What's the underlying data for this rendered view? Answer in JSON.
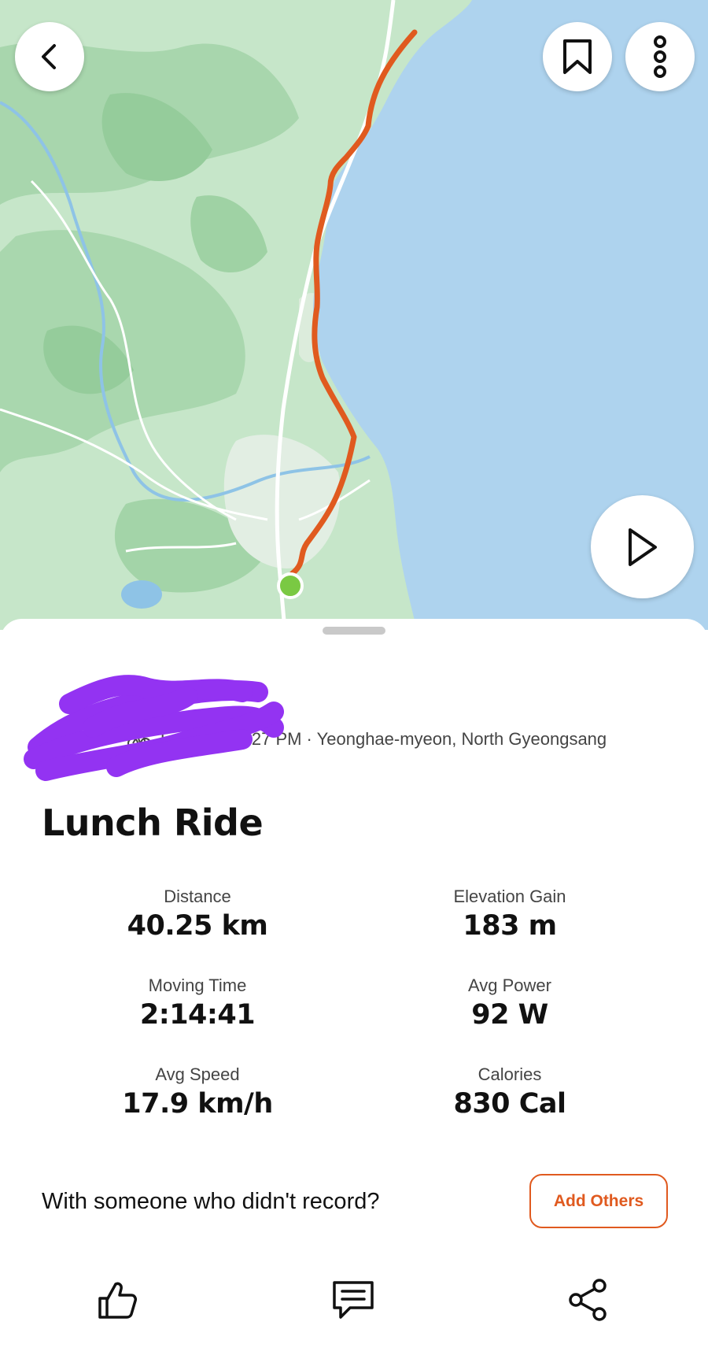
{
  "map": {
    "colors": {
      "water": "#aed3ee",
      "land": "#bfe4c4",
      "route": "#e05a1f",
      "start_marker": "#7ac943"
    },
    "icons": {
      "back": "chevron-left-icon",
      "save": "bookmark-icon",
      "more": "more-vertical-icon",
      "play": "play-icon"
    }
  },
  "activity": {
    "meta": "Today at 12:27 PM · Yeonghae-myeon, North Gyeongsang",
    "sport_icon": "bike-icon",
    "title": "Lunch Ride"
  },
  "stats": [
    {
      "label": "Distance",
      "value": "40.25 km"
    },
    {
      "label": "Elevation Gain",
      "value": "183 m"
    },
    {
      "label": "Moving Time",
      "value": "2:14:41"
    },
    {
      "label": "Avg Power",
      "value": "92 W"
    },
    {
      "label": "Avg Speed",
      "value": "17.9 km/h"
    },
    {
      "label": "Calories",
      "value": "830 Cal"
    }
  ],
  "together": {
    "prompt": "With someone who didn't record?",
    "button": "Add Others"
  },
  "actions": {
    "like_icon": "thumbs-up-icon",
    "comment_icon": "comment-icon",
    "share_icon": "share-icon"
  },
  "accent_color": "#e05a1f"
}
